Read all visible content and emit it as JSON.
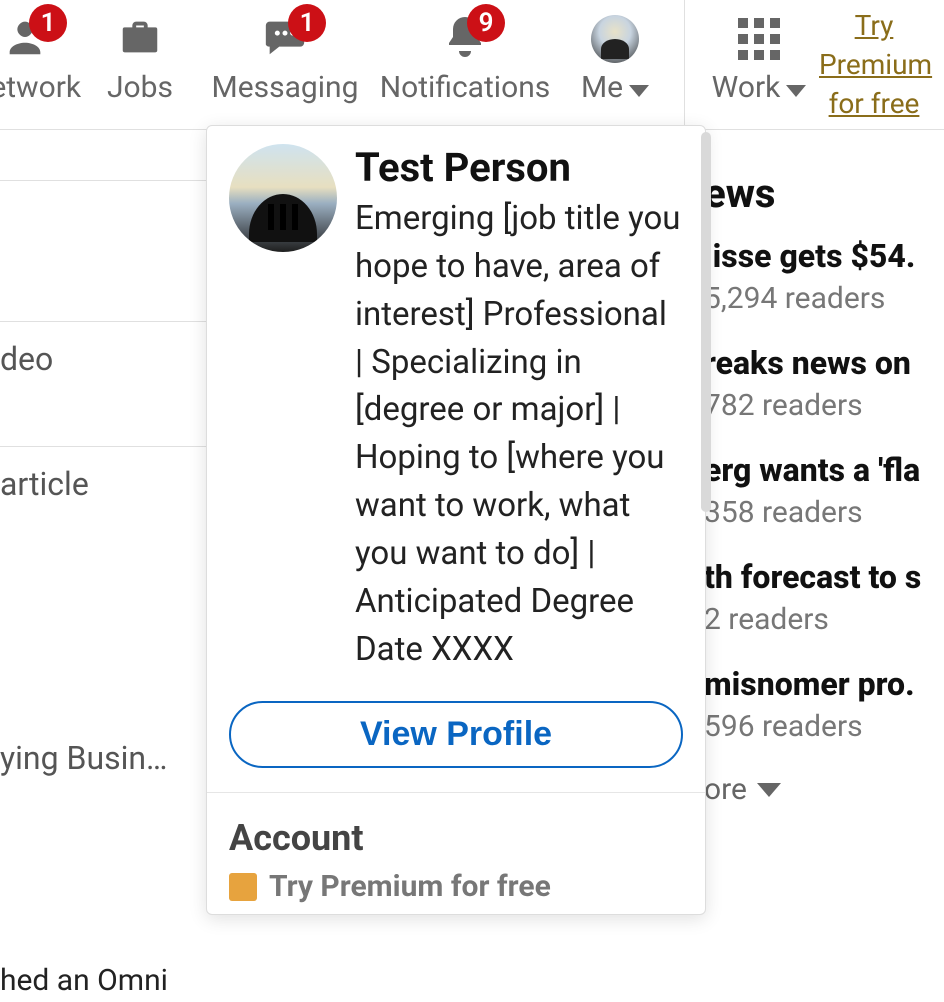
{
  "nav": {
    "network": {
      "label": "Network",
      "badge": "1"
    },
    "jobs": {
      "label": "Jobs"
    },
    "messaging": {
      "label": "Messaging",
      "badge": "1"
    },
    "notifications": {
      "label": "Notifications",
      "badge": "9"
    },
    "me": {
      "label": "Me"
    },
    "work": {
      "label": "Work"
    },
    "premium_link": "Try Premium for free"
  },
  "left": {
    "video": "deo",
    "article": "article",
    "business": "ying Busin…",
    "feed": "hed an Omni"
  },
  "dropdown": {
    "name": "Test Person",
    "headline": "Emerging [job title you hope to have, area of interest] Professional | Specializing in [degree or major] | Hoping to [where you want to work, what you want to do] | Anticipated Degree Date XXXX",
    "view_profile": "View Profile",
    "account_heading": "Account",
    "try_premium": "Try Premium for free"
  },
  "news": {
    "title": "ews",
    "items": [
      {
        "headline": "iisse gets $54.",
        "meta": "5,294 readers"
      },
      {
        "headline": "reaks news on",
        "meta": "782 readers"
      },
      {
        "headline": "erg wants a 'fla",
        "meta": "358 readers"
      },
      {
        "headline": "th forecast to s",
        "meta": "2 readers"
      },
      {
        "headline": "misnomer pro.",
        "meta": "596 readers"
      }
    ],
    "show_more": "ore"
  }
}
